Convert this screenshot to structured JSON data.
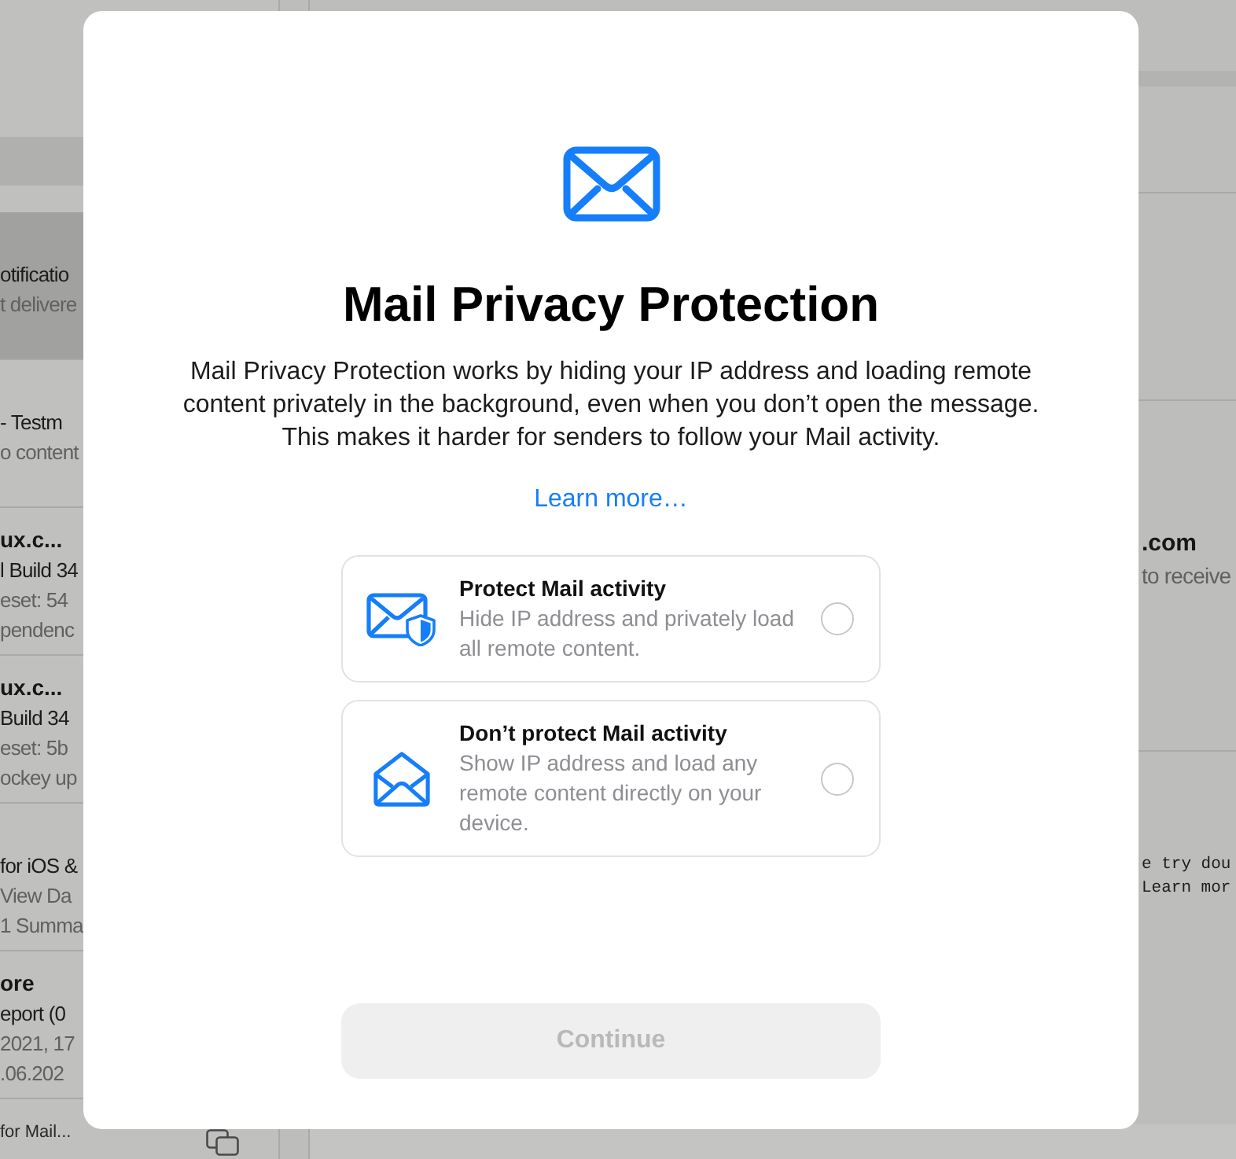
{
  "mail_list": {
    "rows": [
      {
        "selected": true,
        "lines": [
          {
            "kind": "subject",
            "text": "otificatio"
          },
          {
            "kind": "preview",
            "text": "t delivere"
          }
        ]
      },
      {
        "selected": false,
        "lines": [
          {
            "kind": "subject",
            "text": "- Testm"
          },
          {
            "kind": "preview",
            "text": "o content"
          }
        ]
      },
      {
        "selected": false,
        "lines": [
          {
            "kind": "sender",
            "text": "ux.c..."
          },
          {
            "kind": "subject",
            "text": "l Build 34"
          },
          {
            "kind": "preview",
            "text": "eset: 54"
          },
          {
            "kind": "preview",
            "text": "pendenc"
          }
        ]
      },
      {
        "selected": false,
        "lines": [
          {
            "kind": "sender",
            "text": "ux.c..."
          },
          {
            "kind": "subject",
            "text": "Build 34"
          },
          {
            "kind": "preview",
            "text": "eset: 5b"
          },
          {
            "kind": "preview",
            "text": "ockey up"
          }
        ]
      },
      {
        "selected": false,
        "lines": [
          {
            "kind": "subject",
            "text": "for iOS &"
          },
          {
            "kind": "preview",
            "text": "View Da"
          },
          {
            "kind": "preview",
            "text": "1 Summa"
          }
        ]
      },
      {
        "selected": false,
        "lines": [
          {
            "kind": "sender",
            "text": "ore"
          },
          {
            "kind": "subject",
            "text": "eport (0"
          },
          {
            "kind": "preview",
            "text": "2021, 17"
          },
          {
            "kind": "preview",
            "text": ".06.202"
          }
        ]
      }
    ],
    "status": "for Mail..."
  },
  "message_pane": {
    "sections": [
      {
        "lines": [
          {
            "kind": "sender",
            "text": ".com"
          },
          {
            "kind": "preview",
            "text": "to receive"
          }
        ]
      },
      {
        "lines": [
          {
            "kind": "code",
            "text": "e try dou"
          },
          {
            "kind": "code",
            "text": "Learn mor"
          }
        ]
      }
    ]
  },
  "dialog": {
    "title": "Mail Privacy Protection",
    "description": "Mail Privacy Protection works by hiding your IP address and loading remote content privately in the background, even when you don’t open the message. This makes it harder for senders to follow your Mail activity.",
    "link": "Learn more…",
    "options": [
      {
        "kind": "protect",
        "title": "Protect Mail activity",
        "description": "Hide IP address and privately load all remote content.",
        "selected": false
      },
      {
        "kind": "dont_protect",
        "title": "Don’t protect Mail activity",
        "description": "Show IP address and load any remote content directly on your device.",
        "selected": false
      }
    ],
    "continue_button": {
      "label": "Continue",
      "disabled": true
    }
  }
}
